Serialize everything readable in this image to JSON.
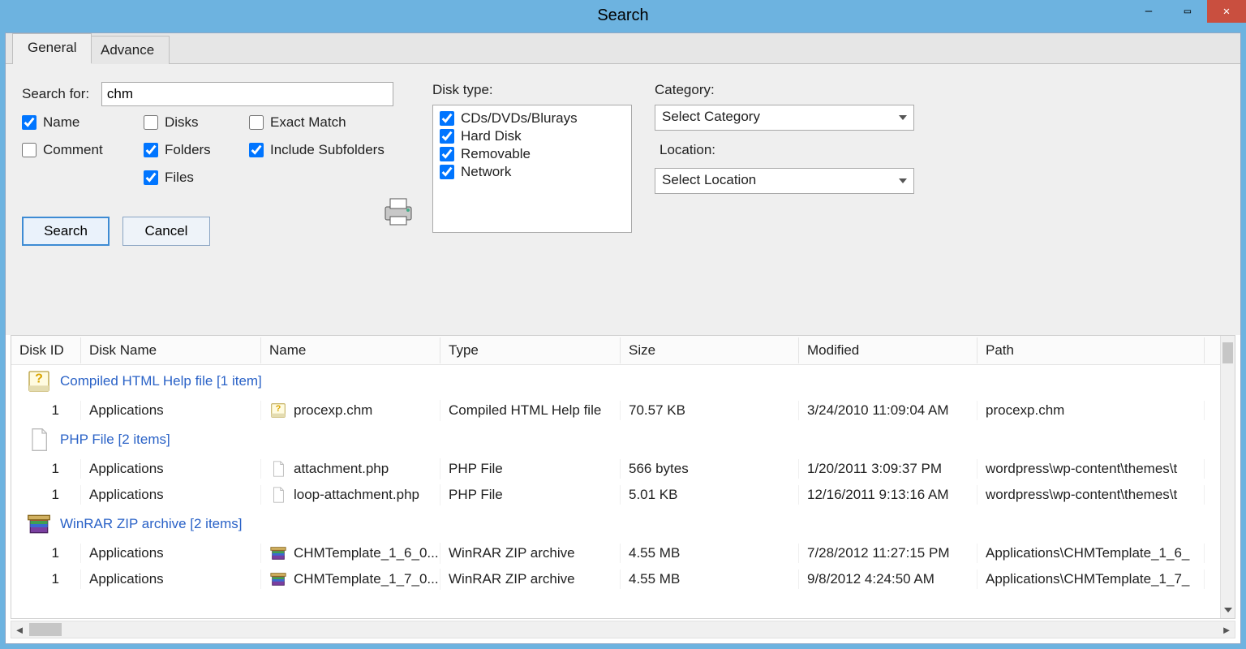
{
  "window": {
    "title": "Search"
  },
  "tabs": {
    "general": "General",
    "advance": "Advance"
  },
  "form": {
    "search_for_label": "Search for:",
    "search_for_value": "chm",
    "cb_name": "Name",
    "cb_comment": "Comment",
    "cb_disks": "Disks",
    "cb_folders": "Folders",
    "cb_files": "Files",
    "cb_exact": "Exact Match",
    "cb_include_sub": "Include Subfolders",
    "btn_search": "Search",
    "btn_cancel": "Cancel",
    "disk_type_label": "Disk type:",
    "disk_types": {
      "cds": "CDs/DVDs/Blurays",
      "hdd": "Hard Disk",
      "rem": "Removable",
      "net": "Network"
    },
    "category_label": "Category:",
    "category_value": "Select Category",
    "location_label": "Location:",
    "location_value": "Select Location"
  },
  "grid": {
    "headers": {
      "disk_id": "Disk ID",
      "disk_name": "Disk Name",
      "name": "Name",
      "type": "Type",
      "size": "Size",
      "modified": "Modified",
      "path": "Path"
    },
    "groups": [
      {
        "label": "Compiled HTML Help file [1 item]",
        "icon": "chm",
        "rows": [
          {
            "disk_id": "1",
            "disk_name": "Applications",
            "name": "procexp.chm",
            "type": "Compiled HTML Help file",
            "size": "70.57 KB",
            "modified": "3/24/2010 11:09:04 AM",
            "path": "procexp.chm",
            "icon": "chm"
          }
        ]
      },
      {
        "label": "PHP File [2 items]",
        "icon": "file",
        "rows": [
          {
            "disk_id": "1",
            "disk_name": "Applications",
            "name": "attachment.php",
            "type": "PHP File",
            "size": "566 bytes",
            "modified": "1/20/2011 3:09:37 PM",
            "path": "wordpress\\wp-content\\themes\\t",
            "icon": "file"
          },
          {
            "disk_id": "1",
            "disk_name": "Applications",
            "name": "loop-attachment.php",
            "type": "PHP File",
            "size": "5.01 KB",
            "modified": "12/16/2011 9:13:16 AM",
            "path": "wordpress\\wp-content\\themes\\t",
            "icon": "file"
          }
        ]
      },
      {
        "label": "WinRAR ZIP archive [2 items]",
        "icon": "rar",
        "rows": [
          {
            "disk_id": "1",
            "disk_name": "Applications",
            "name": "CHMTemplate_1_6_0...",
            "type": "WinRAR ZIP archive",
            "size": "4.55 MB",
            "modified": "7/28/2012 11:27:15 PM",
            "path": "Applications\\CHMTemplate_1_6_",
            "icon": "rar"
          },
          {
            "disk_id": "1",
            "disk_name": "Applications",
            "name": "CHMTemplate_1_7_0...",
            "type": "WinRAR ZIP archive",
            "size": "4.55 MB",
            "modified": "9/8/2012 4:24:50 AM",
            "path": "Applications\\CHMTemplate_1_7_",
            "icon": "rar"
          }
        ]
      }
    ]
  }
}
